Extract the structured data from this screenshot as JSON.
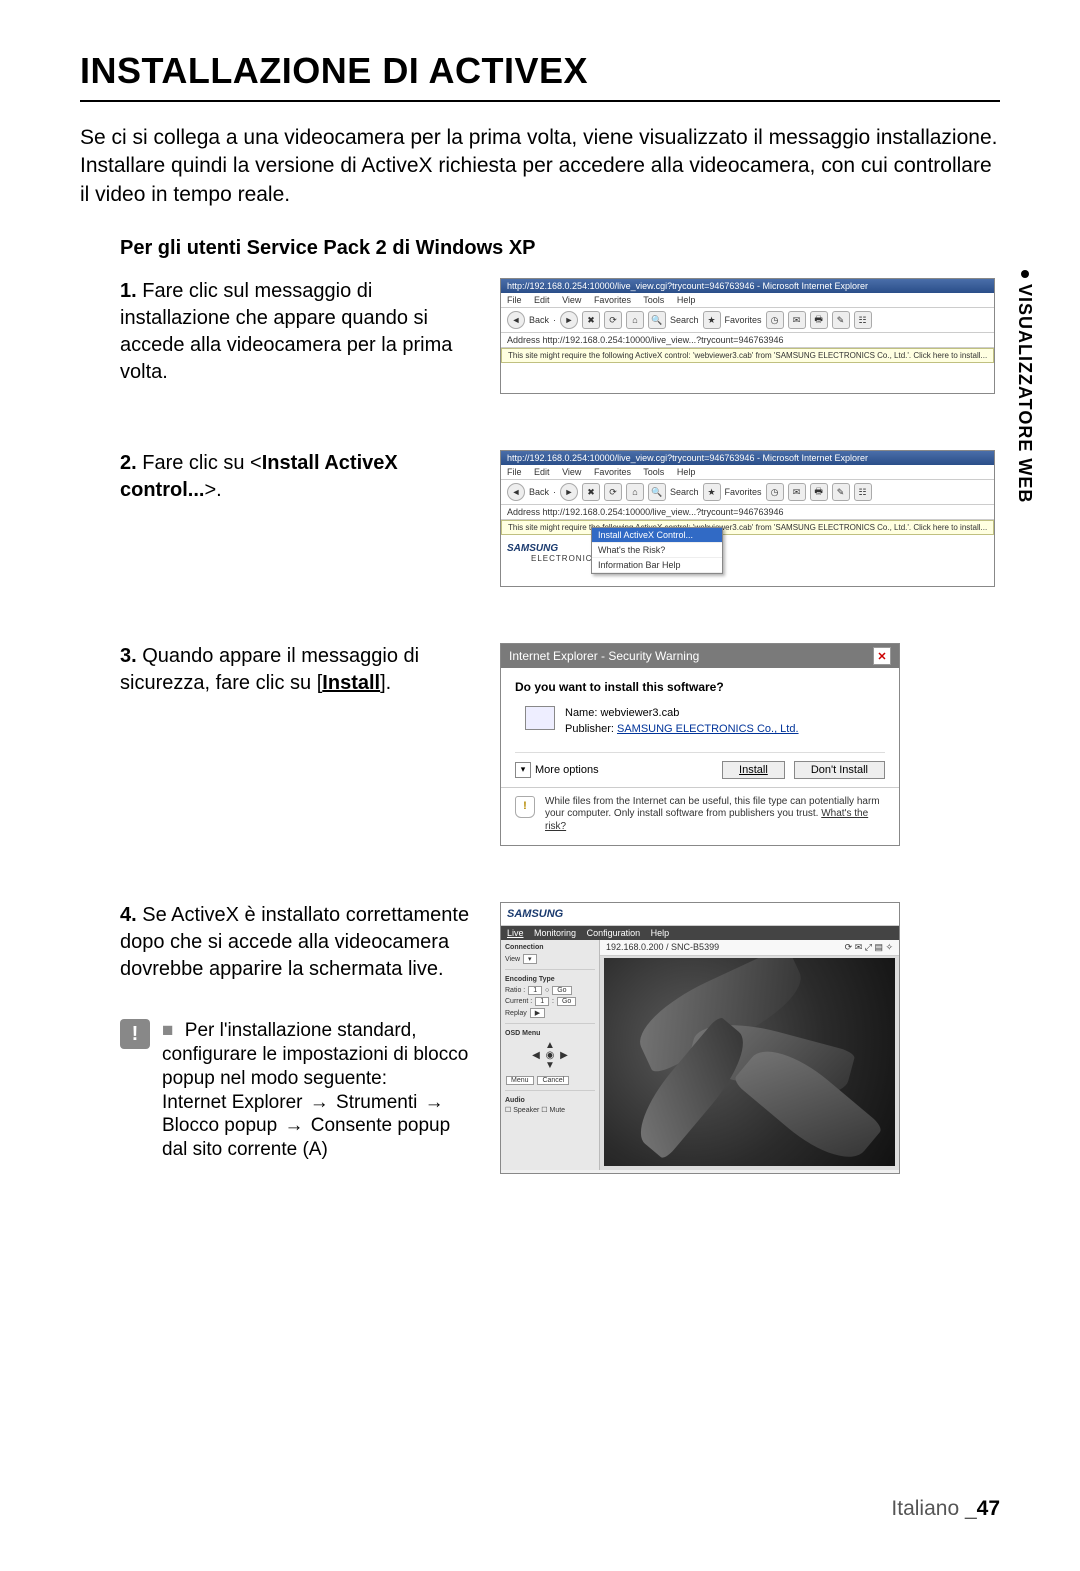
{
  "page": {
    "title": "INSTALLAZIONE DI ACTIVEX",
    "intro": "Se ci si collega a una videocamera per la prima volta, viene visualizzato il messaggio installazione. Installare quindi la versione di ActiveX richiesta per accedere alla videocamera, con cui controllare il video in tempo reale.",
    "subhead": "Per gli utenti Service Pack 2 di Windows XP",
    "side_tab": "VISUALIZZATORE WEB",
    "footer_lang": "Italiano _",
    "footer_page": "47"
  },
  "steps": {
    "s1_num": "1.",
    "s1_text": " Fare clic sul messaggio di installazione che appare quando si accede alla videocamera per la prima volta.",
    "s2_num": "2.",
    "s2_pre": " Fare clic su <",
    "s2_bold": "Install ActiveX control...",
    "s2_post": ">.",
    "s3_num": "3.",
    "s3_pre": " Quando appare il messaggio di sicurezza, fare clic su [",
    "s3_bold": "Install",
    "s3_post": "].",
    "s4_num": "4.",
    "s4_text": " Se ActiveX è installato correttamente dopo che si accede alla videocamera dovrebbe apparire la schermata live."
  },
  "note": {
    "bullet": "■",
    "line1": "Per l'installazione standard, configurare le impostazioni di blocco popup nel modo seguente:",
    "path1": "Internet Explorer",
    "arrow": "→",
    "path2": "Strumenti",
    "path3": "Blocco popup",
    "path4": "Consente popup dal sito corrente (A)"
  },
  "ie": {
    "window_title_1": "http://192.168.0.254:10000/live_view.cgi?trycount=946763946 - Microsoft Internet Explorer",
    "window_title_2": "http://192.168.0.254:10000/live_view.cgi?trycount=946763946 - Microsoft Internet Explorer",
    "menu": {
      "file": "File",
      "edit": "Edit",
      "view": "View",
      "fav": "Favorites",
      "tools": "Tools",
      "help": "Help"
    },
    "back": "Back",
    "search": "Search",
    "favorites": "Favorites",
    "address_label": "Address",
    "address_url": "http://192.168.0.254:10000/live_view...?trycount=946763946",
    "infobar": "This site might require the following ActiveX control: 'webviewer3.cab' from 'SAMSUNG ELECTRONICS Co., Ltd.'. Click here to install...",
    "ctx_install": "Install ActiveX Control...",
    "ctx_risk": "What's the Risk?",
    "ctx_infobar": "Information Bar Help",
    "samsung": "SAMSUNG",
    "samsung_sub": "ELECTRONICS"
  },
  "sec": {
    "title": "Internet Explorer - Security Warning",
    "question": "Do you want to install this software?",
    "name_label": "Name:",
    "name_val": "webviewer3.cab",
    "pub_label": "Publisher:",
    "pub_val": "SAMSUNG ELECTRONICS Co., Ltd.",
    "more": "More options",
    "install": "Install",
    "dont": "Don't Install",
    "foot1": "While files from the Internet can be useful, this file type can potentially harm your computer. Only install software from publishers you trust. ",
    "risk": "What's the risk?"
  },
  "live": {
    "brand": "SAMSUNG",
    "tabs": {
      "live": "Live",
      "monitor": "Monitoring",
      "config": "Configuration",
      "help": "Help"
    },
    "ip": "192.168.0.200 / SNC-B5399",
    "top_icons": "⟳ ✉ ⤢ ▤ ✧",
    "side": {
      "conn_t": "Connection",
      "view": "View",
      "encode_t": "Encoding Type",
      "ratio": "Ratio",
      "ratio_v": "1",
      "go": "Go",
      "current": "Current",
      "cur_v": "1",
      "replay": "Replay",
      "osd_t": "OSD Menu",
      "menu": "Menu",
      "cancel": "Cancel",
      "audio_t": "Audio",
      "speaker": "Speaker",
      "mute": "Mute"
    }
  }
}
